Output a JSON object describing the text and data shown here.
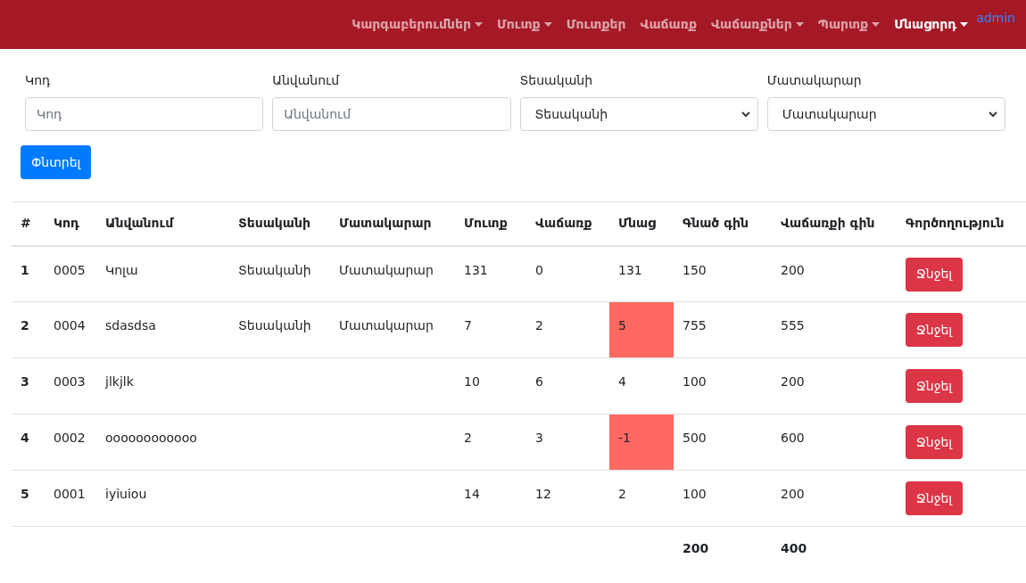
{
  "navbar": {
    "items": [
      {
        "label": "Կարգաբերումներ",
        "dropdown": true,
        "active": false
      },
      {
        "label": "Մուտք",
        "dropdown": true,
        "active": false
      },
      {
        "label": "Մուտքեր",
        "dropdown": false,
        "active": false
      },
      {
        "label": "Վաճառք",
        "dropdown": false,
        "active": false
      },
      {
        "label": "Վաճառքներ",
        "dropdown": true,
        "active": false
      },
      {
        "label": "Պարտք",
        "dropdown": true,
        "active": false
      },
      {
        "label": "Մնացորդ",
        "dropdown": true,
        "active": true
      }
    ],
    "user": "admin"
  },
  "filters": [
    {
      "kind": "input",
      "label": "Կոդ",
      "placeholder": "Կոդ"
    },
    {
      "kind": "input",
      "label": "Անվանում",
      "placeholder": "Անվանում"
    },
    {
      "kind": "select",
      "label": "Տեսականի",
      "value": "Տեսականի"
    },
    {
      "kind": "select",
      "label": "Մատակարար",
      "value": "Մատակարար"
    }
  ],
  "search_button": "Փնտրել",
  "table": {
    "columns": [
      "#",
      "Կոդ",
      "Անվանում",
      "Տեսականի",
      "Մատակարար",
      "Մուտք",
      "Վաճառք",
      "Մնաց",
      "Գնած գին",
      "Վաճառքի գին",
      "Գործողություն"
    ],
    "rows": [
      {
        "cells": [
          "1",
          "0005",
          "Կոլա",
          "Տեսականի",
          "Մատակարար",
          "131",
          "0",
          "131",
          "150",
          "200"
        ],
        "low_stock": false,
        "action": "Ջնջել"
      },
      {
        "cells": [
          "2",
          "0004",
          "sdasdsa",
          "Տեսականի",
          "Մատակարար",
          "7",
          "2",
          "5",
          "755",
          "555"
        ],
        "low_stock": true,
        "action": "Ջնջել"
      },
      {
        "cells": [
          "3",
          "0003",
          "jlkjlk",
          "",
          "",
          "10",
          "6",
          "4",
          "100",
          "200"
        ],
        "low_stock": false,
        "action": "Ջնջել"
      },
      {
        "cells": [
          "4",
          "0002",
          "oooooooooooo",
          "",
          "",
          "2",
          "3",
          "-1",
          "500",
          "600"
        ],
        "low_stock": true,
        "action": "Ջնջել"
      },
      {
        "cells": [
          "5",
          "0001",
          "iyiuiou",
          "",
          "",
          "14",
          "12",
          "2",
          "100",
          "200"
        ],
        "low_stock": false,
        "action": "Ջնջել"
      }
    ],
    "totals": {
      "purchase_price": "200",
      "sale_price": "400"
    }
  }
}
